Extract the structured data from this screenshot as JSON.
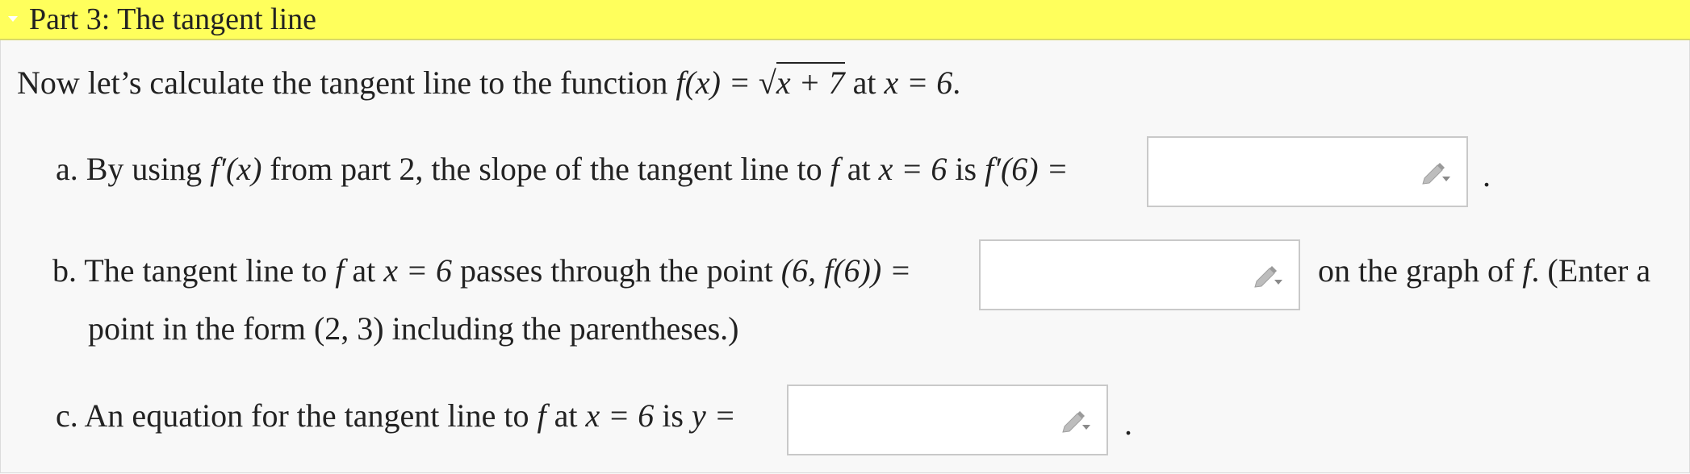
{
  "header": {
    "title": "Part 3: The tangent line"
  },
  "intro": {
    "text_before": "Now let’s calculate the tangent line to the function ",
    "math_f": "f(x) = ",
    "math_sqrt_arg": "x + 7",
    "text_at": " at ",
    "math_x": "x = 6",
    "period": "."
  },
  "part_a": {
    "label": "a. By using ",
    "math_fprime_x": "f′(x)",
    "text1": " from part 2, the slope of the tangent line to ",
    "math_f": "f",
    "text_at": " at ",
    "math_x": "x = 6",
    "text_is": " is ",
    "math_fprime6": "f′(6) =",
    "input_value": "",
    "after": "."
  },
  "part_b": {
    "label": "b. The tangent line to ",
    "math_f": "f",
    "text_at": " at ",
    "math_x": "x = 6",
    "text_passes": " passes through the point ",
    "math_point": "(6, f(6)) =",
    "input_value": "",
    "after1": "on the graph of ",
    "math_f2": "f",
    "after2": ". (Enter a",
    "line2": "point in the form (2, 3) including the parentheses.)"
  },
  "part_c": {
    "label": "c. An equation for the tangent line to ",
    "math_f": "f",
    "text_at": " at ",
    "math_x": "x = 6",
    "text_is": " is ",
    "math_y": "y =",
    "input_value": "",
    "after": "."
  },
  "icons": {
    "edit": "pencil-edit-icon"
  }
}
